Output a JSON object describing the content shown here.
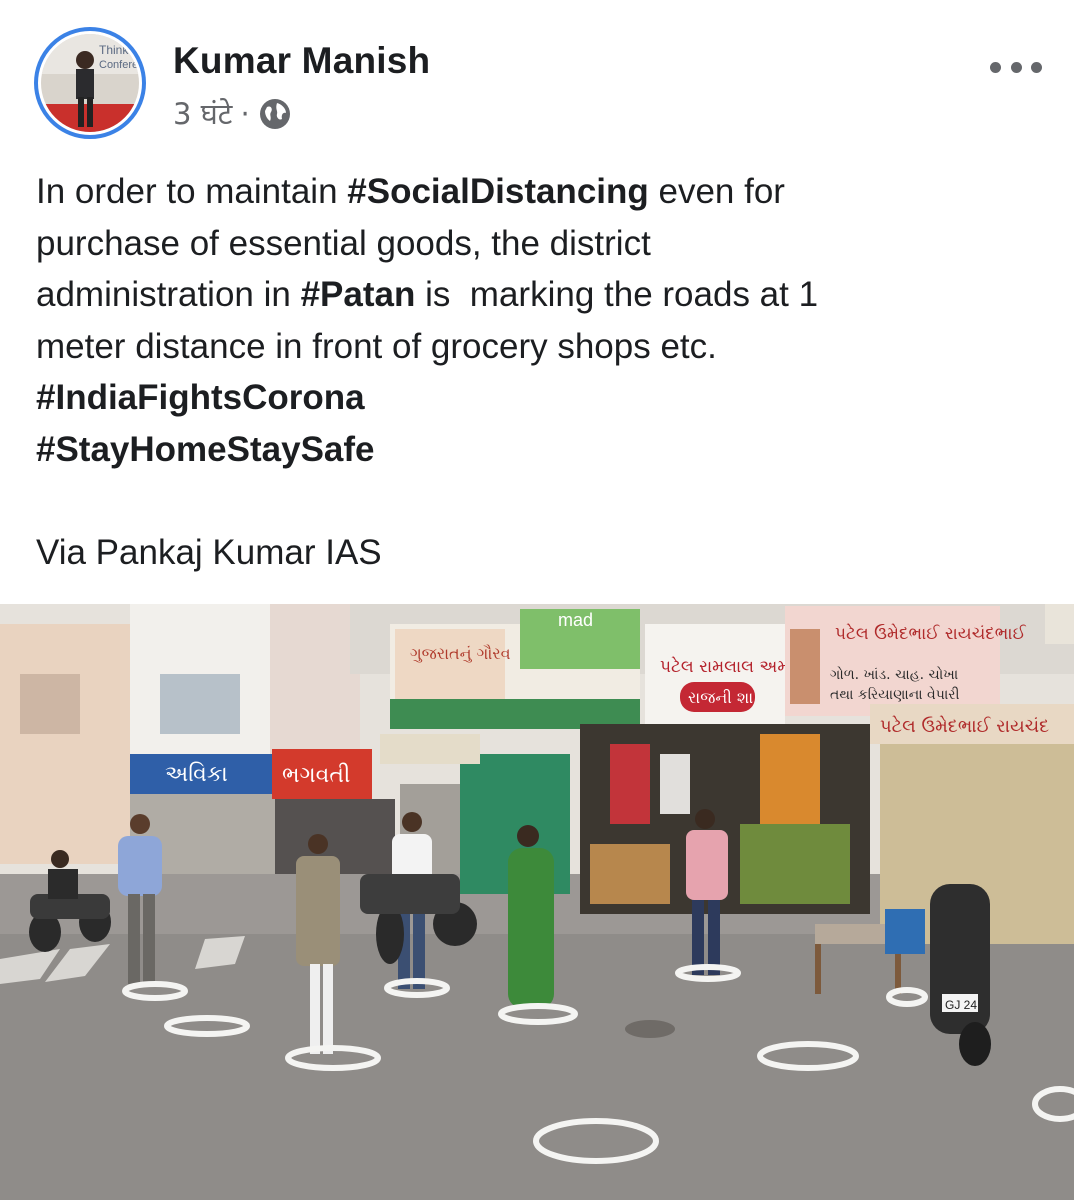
{
  "post": {
    "author": "Kumar Manish",
    "timestamp": "3 घंटे",
    "separator": "·",
    "privacy_icon": "globe-icon",
    "more_icon": "more-horizontal-icon",
    "avatar": {
      "badge_text_1": "Thinkers",
      "badge_text_2": "Conference"
    },
    "text": {
      "l1_a": "In order to maintain ",
      "l1_tag": "#SocialDistancing",
      "l1_b": " even for",
      "l2": "purchase of essential goods, the district",
      "l3_a": "administration in ",
      "l3_tag": "#Patan",
      "l3_b": " is  marking the roads at 1",
      "l4": "meter distance in front of grocery shops etc.",
      "tag1": "#IndiaFightsCorona",
      "tag2": "#StayHomeStaySafe",
      "via": "Via Pankaj Kumar IAS"
    },
    "photo": {
      "signs": {
        "bhagwati": "ભગવતી",
        "avkar": "અવિકા",
        "mad": "mad",
        "patel_shop": "પટેલ રામલાલ અમથાલાલ",
        "rajni": "રાજની શા",
        "patel_umed": "પટેલ ઉમેદભાઈ રાયચંદભાઈ",
        "patel_umed_2": "પટેલ ઉમેદભાઈ રાયચંદ",
        "gol": "ગોળ. ખાંડ. ચાહ. ચોખા",
        "gol_2": "તથા કરિયાણાના વેપારી",
        "gujarat": "ગુજરાતનું ગૌરવ",
        "plate": "GJ 24"
      }
    }
  },
  "colors": {
    "name": "#1c1e21",
    "meta": "#65676b",
    "avatar_ring": "#3b82e6"
  }
}
